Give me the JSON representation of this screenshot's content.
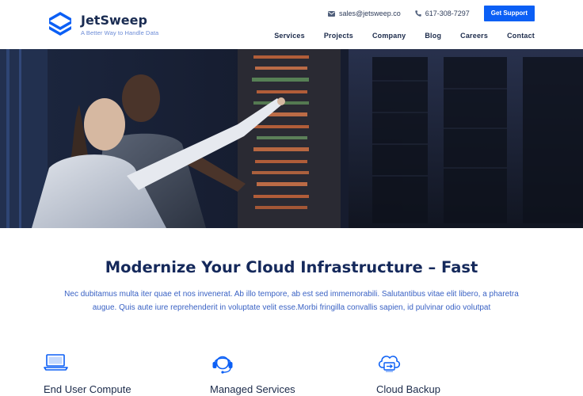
{
  "brand": {
    "name": "JetSweep",
    "tagline": "A Better Way to Handle Data",
    "logo_icon": "stacked-chevrons-logo",
    "accent": "#0b5ff5",
    "navy": "#15295b"
  },
  "topbar": {
    "email": "sales@jetsweep.co",
    "phone": "617-308-7297",
    "support_label": "Get Support"
  },
  "nav": [
    "Services",
    "Projects",
    "Company",
    "Blog",
    "Careers",
    "Contact"
  ],
  "hero": {
    "image": "two-technicians-server-rack-photo"
  },
  "intro": {
    "title": "Modernize Your Cloud Infrastructure – Fast",
    "body_line1": "Nec dubitamus multa iter quae et nos invenerat. Ab illo tempore, ab est sed immemorabili. Salutantibus vitae elit libero, a pharetra",
    "body_line2": "augue. Quis aute iure reprehenderit in voluptate velit esse.Morbi fringilla convallis sapien, id pulvinar odio volutpat"
  },
  "services": [
    {
      "label": "End User Compute",
      "icon": "laptop-icon"
    },
    {
      "label": "Managed Services",
      "icon": "headset-icon"
    },
    {
      "label": "Cloud Backup",
      "icon": "cloud-backup-icon"
    }
  ]
}
